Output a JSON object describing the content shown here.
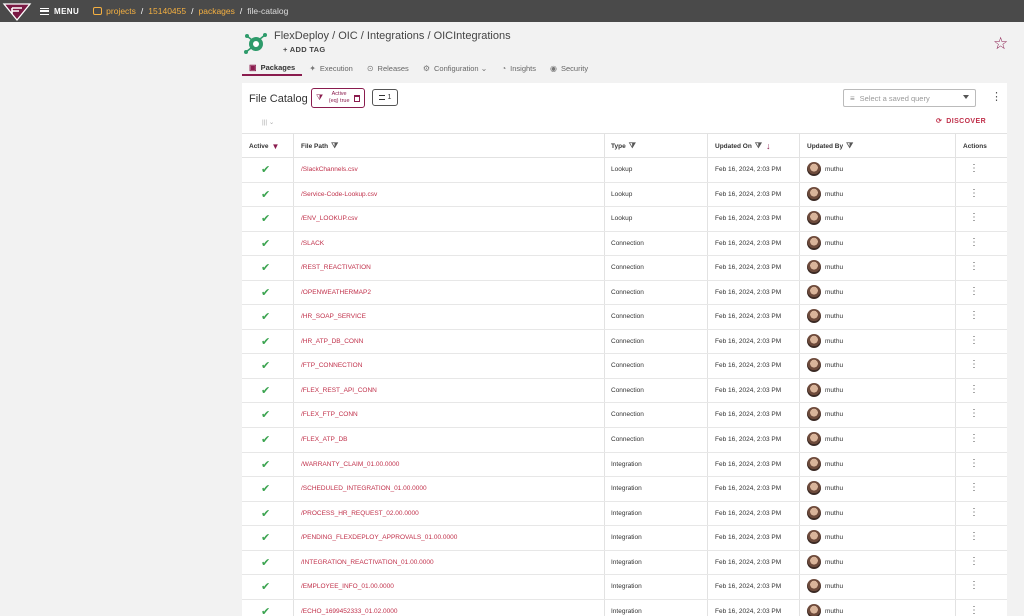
{
  "topbar": {
    "menu_label": "MENU",
    "breadcrumbs": [
      "projects",
      "15140455",
      "packages"
    ],
    "current": "file-catalog"
  },
  "header": {
    "title": "FlexDeploy / OIC / Integrations / OICIntegrations",
    "add_tag": "+ ADD TAG"
  },
  "tabs": [
    {
      "label": "Packages",
      "icon": "package-icon",
      "active": true
    },
    {
      "label": "Execution",
      "icon": "run-icon"
    },
    {
      "label": "Releases",
      "icon": "release-icon"
    },
    {
      "label": "Configuration",
      "icon": "gear-icon"
    },
    {
      "label": "Insights",
      "icon": "insights-icon"
    },
    {
      "label": "Security",
      "icon": "security-icon"
    }
  ],
  "catalog": {
    "title": "File Catalog",
    "filter_chip": {
      "line1": "Active",
      "line2": "(eq) true"
    },
    "sort_count": "1",
    "saved_query_placeholder": "Select a saved query",
    "columns_toggle": "|||  ⌄",
    "discover_label": "DISCOVER"
  },
  "columns": {
    "active": "Active",
    "file_path": "File Path",
    "type": "Type",
    "updated_on": "Updated On",
    "updated_by": "Updated By",
    "actions": "Actions"
  },
  "rows": [
    {
      "path": "/SlackChannels.csv",
      "type": "Lookup",
      "updated": "Feb 16, 2024, 2:03 PM",
      "user": "muthu"
    },
    {
      "path": "/Service-Code-Lookup.csv",
      "type": "Lookup",
      "updated": "Feb 16, 2024, 2:03 PM",
      "user": "muthu"
    },
    {
      "path": "/ENV_LOOKUP.csv",
      "type": "Lookup",
      "updated": "Feb 16, 2024, 2:03 PM",
      "user": "muthu"
    },
    {
      "path": "/SLACK",
      "type": "Connection",
      "updated": "Feb 16, 2024, 2:03 PM",
      "user": "muthu"
    },
    {
      "path": "/REST_REACTIVATION",
      "type": "Connection",
      "updated": "Feb 16, 2024, 2:03 PM",
      "user": "muthu"
    },
    {
      "path": "/OPENWEATHERMAP2",
      "type": "Connection",
      "updated": "Feb 16, 2024, 2:03 PM",
      "user": "muthu"
    },
    {
      "path": "/HR_SOAP_SERVICE",
      "type": "Connection",
      "updated": "Feb 16, 2024, 2:03 PM",
      "user": "muthu"
    },
    {
      "path": "/HR_ATP_DB_CONN",
      "type": "Connection",
      "updated": "Feb 16, 2024, 2:03 PM",
      "user": "muthu"
    },
    {
      "path": "/FTP_CONNECTION",
      "type": "Connection",
      "updated": "Feb 16, 2024, 2:03 PM",
      "user": "muthu"
    },
    {
      "path": "/FLEX_REST_API_CONN",
      "type": "Connection",
      "updated": "Feb 16, 2024, 2:03 PM",
      "user": "muthu"
    },
    {
      "path": "/FLEX_FTP_CONN",
      "type": "Connection",
      "updated": "Feb 16, 2024, 2:03 PM",
      "user": "muthu"
    },
    {
      "path": "/FLEX_ATP_DB",
      "type": "Connection",
      "updated": "Feb 16, 2024, 2:03 PM",
      "user": "muthu"
    },
    {
      "path": "/WARRANTY_CLAIM_01.00.0000",
      "type": "Integration",
      "updated": "Feb 16, 2024, 2:03 PM",
      "user": "muthu"
    },
    {
      "path": "/SCHEDULED_INTEGRATION_01.00.0000",
      "type": "Integration",
      "updated": "Feb 16, 2024, 2:03 PM",
      "user": "muthu"
    },
    {
      "path": "/PROCESS_HR_REQUEST_02.00.0000",
      "type": "Integration",
      "updated": "Feb 16, 2024, 2:03 PM",
      "user": "muthu"
    },
    {
      "path": "/PENDING_FLEXDEPLOY_APPROVALS_01.00.0000",
      "type": "Integration",
      "updated": "Feb 16, 2024, 2:03 PM",
      "user": "muthu"
    },
    {
      "path": "/INTEGRATION_REACTIVATION_01.00.0000",
      "type": "Integration",
      "updated": "Feb 16, 2024, 2:03 PM",
      "user": "muthu"
    },
    {
      "path": "/EMPLOYEE_INFO_01.00.0000",
      "type": "Integration",
      "updated": "Feb 16, 2024, 2:03 PM",
      "user": "muthu"
    },
    {
      "path": "/ECHO_1699452333_01.02.0000",
      "type": "Integration",
      "updated": "Feb 16, 2024, 2:03 PM",
      "user": "muthu"
    }
  ],
  "colors": {
    "accent": "#8a1c4e",
    "link": "#c0304a",
    "success": "#3aa34f",
    "breadcrumb": "#f5b041"
  }
}
